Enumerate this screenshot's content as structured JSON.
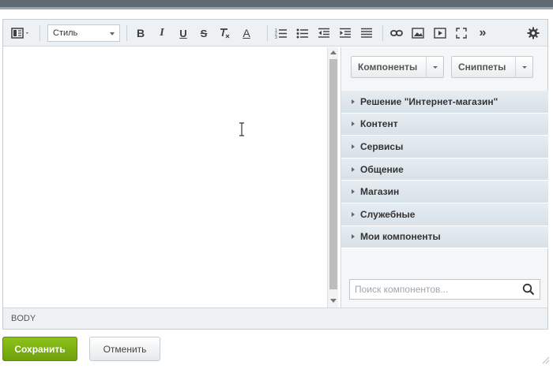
{
  "toolbar": {
    "style_select_value": "Стиль",
    "icons": [
      "view-mode-icon",
      "bold-icon",
      "italic-icon",
      "underline-icon",
      "strikethrough-icon",
      "remove-format-icon",
      "font-color-icon",
      "ordered-list-icon",
      "unordered-list-icon",
      "outdent-icon",
      "indent-icon",
      "align-icon",
      "link-icon",
      "image-icon",
      "video-icon",
      "fullscreen-icon",
      "more-icon",
      "settings-icon"
    ],
    "bold_label": "B",
    "italic_label": "I",
    "underline_label": "U",
    "strike_label": "S",
    "font_color_label": "A",
    "more_label": "»"
  },
  "panel": {
    "components_button": "Компоненты",
    "snippets_button": "Сниппеты",
    "groups": [
      "Решение \"Интернет-магазин\"",
      "Контент",
      "Сервисы",
      "Общение",
      "Магазин",
      "Служебные",
      "Мои компоненты"
    ],
    "search_placeholder": "Поиск компонентов..."
  },
  "statusbar": {
    "path": "BODY"
  },
  "actions": {
    "save_label": "Сохранить",
    "cancel_label": "Отменить"
  },
  "colors": {
    "save_green": "#7db514",
    "group_header_bg": "#dde6ec",
    "toolbar_bg": "#eef1f3"
  }
}
